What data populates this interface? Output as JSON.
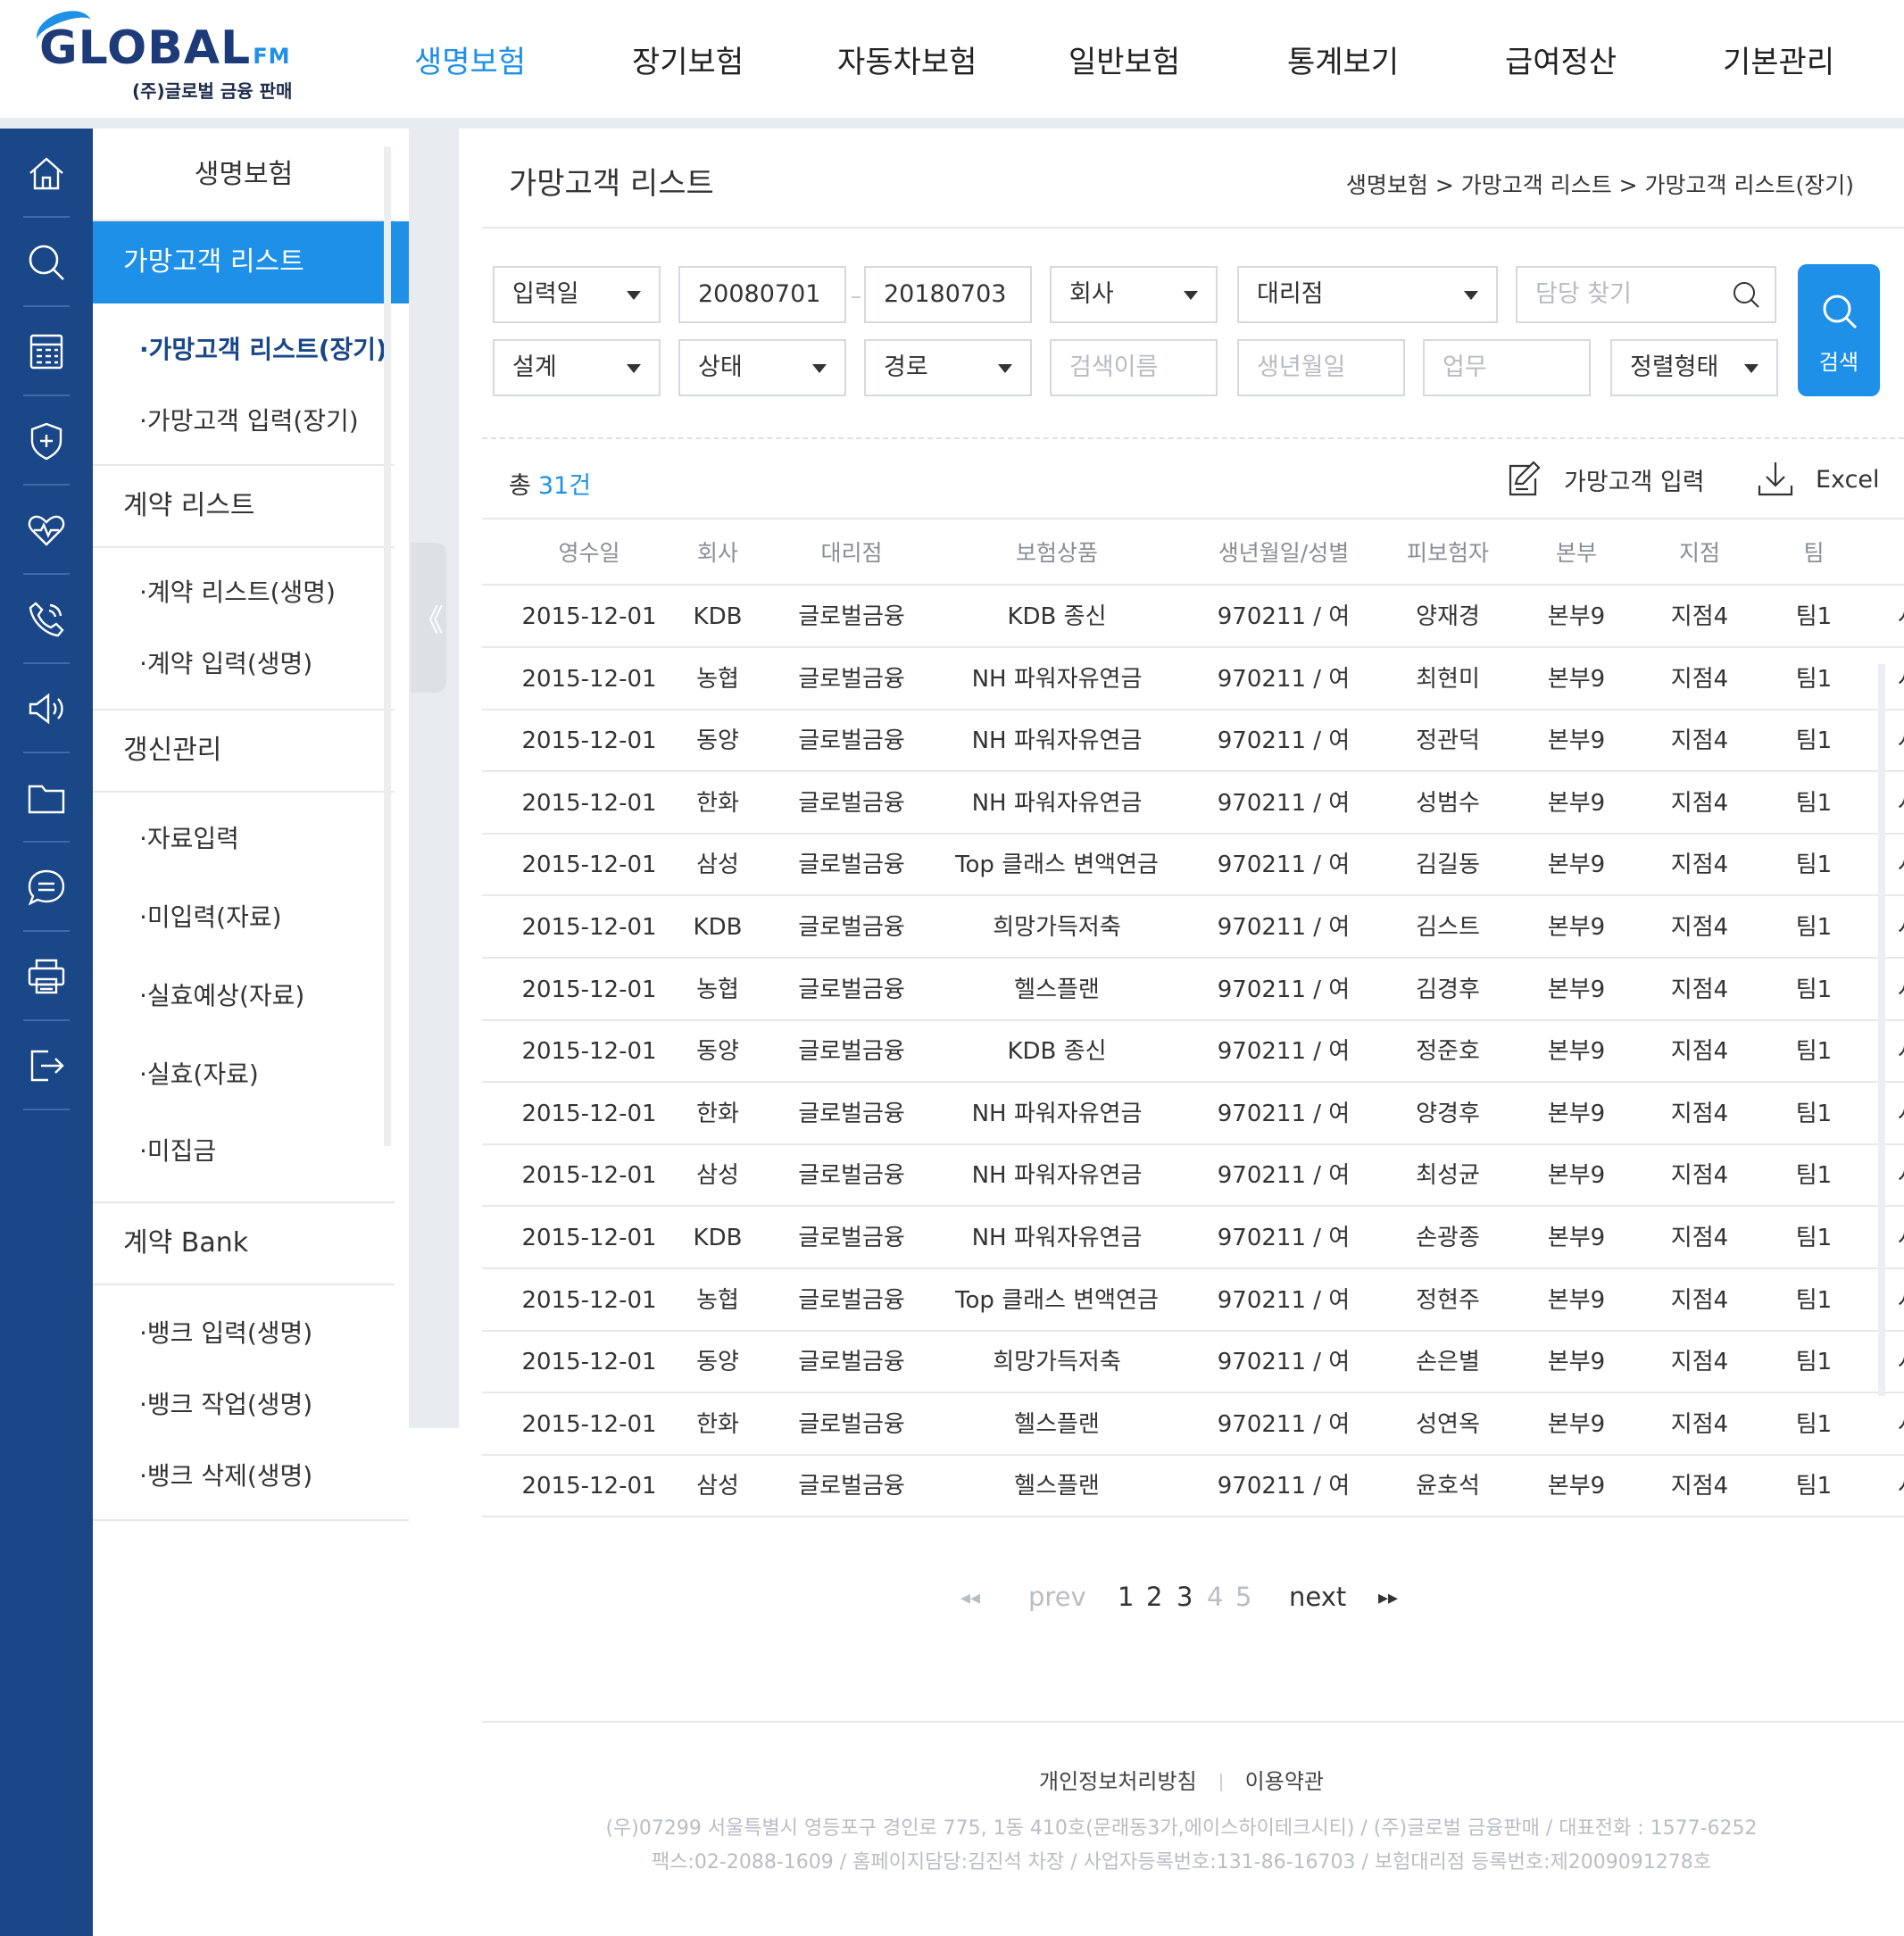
{
  "brand": {
    "logo_text": "GLOBAL",
    "logo_suffix": "FM",
    "logo_sub": "(주)글로벌 금융 판매",
    "accent": "#1e90e8",
    "navy": "#1a4787"
  },
  "gnb": [
    {
      "label": "생명보험",
      "active": true
    },
    {
      "label": "장기보험"
    },
    {
      "label": "자동차보험"
    },
    {
      "label": "일반보험"
    },
    {
      "label": "통계보기"
    },
    {
      "label": "급여정산"
    },
    {
      "label": "기본관리"
    }
  ],
  "iconbar": [
    "home-icon",
    "search-icon",
    "calculator-icon",
    "shield-icon",
    "heart-rate-icon",
    "phone-icon",
    "megaphone-icon",
    "folder-icon",
    "chat-icon",
    "printer-icon",
    "logout-icon"
  ],
  "sidebar": {
    "title": "생명보험",
    "active_section": "가망고객 리스트",
    "links1": [
      "·가망고객 리스트(장기)",
      "·가망고객 입력(장기)"
    ],
    "group2": "계약 리스트",
    "links2": [
      "·계약 리스트(생명)",
      "·계약 입력(생명)"
    ],
    "group3": "갱신관리",
    "links3": [
      "·자료입력",
      "·미입력(자료)",
      "·실효예상(자료)",
      "·실효(자료)",
      "·미집금"
    ],
    "group4": "계약 Bank",
    "links4": [
      "·뱅크 입력(생명)",
      "·뱅크 작업(생명)",
      "·뱅크 삭제(생명)"
    ],
    "collapse_label": "《"
  },
  "page": {
    "title": "가망고객 리스트",
    "breadcrumb": "생명보험  >  가망고객 리스트  >  가망고객 리스트(장기)"
  },
  "filters": {
    "date_type": "입력일",
    "date_from": "20080701",
    "date_to": "20180703",
    "company": "회사",
    "agency": "대리점",
    "manager_placeholder": "담당 찾기",
    "design": "설계",
    "status": "상태",
    "route": "경로",
    "name_placeholder": "검색이름",
    "birth_placeholder": "생년월일",
    "job_placeholder": "업무",
    "sort": "정렬형태",
    "search_label": "검색"
  },
  "summary": {
    "total_label": "총",
    "total_count": "31건",
    "add_label": "가망고객 입력",
    "excel_label": "Excel"
  },
  "table": {
    "headers": [
      "영수일",
      "회사",
      "대리점",
      "보험상품",
      "생년월일/성별",
      "피보험자",
      "본부",
      "지점",
      "팀"
    ],
    "rows": [
      [
        "2015-12-01",
        "KDB",
        "글로벌금융",
        "KDB 종신",
        "970211  / 여",
        "양재경",
        "본부9",
        "지점4",
        "팀1",
        "사:"
      ],
      [
        "2015-12-01",
        "농협",
        "글로벌금융",
        "NH 파워자유연금",
        "970211  / 여",
        "최현미",
        "본부9",
        "지점4",
        "팀1",
        "사:"
      ],
      [
        "2015-12-01",
        "동양",
        "글로벌금융",
        "NH 파워자유연금",
        "970211  / 여",
        "정관덕",
        "본부9",
        "지점4",
        "팀1",
        "사:"
      ],
      [
        "2015-12-01",
        "한화",
        "글로벌금융",
        "NH 파워자유연금",
        "970211  / 여",
        "성범수",
        "본부9",
        "지점4",
        "팀1",
        "사:"
      ],
      [
        "2015-12-01",
        "삼성",
        "글로벌금융",
        "Top 클래스 변액연금",
        "970211  / 여",
        "김길동",
        "본부9",
        "지점4",
        "팀1",
        "사:"
      ],
      [
        "2015-12-01",
        "KDB",
        "글로벌금융",
        "희망가득저축",
        "970211  / 여",
        "김스트",
        "본부9",
        "지점4",
        "팀1",
        "사:"
      ],
      [
        "2015-12-01",
        "농협",
        "글로벌금융",
        "헬스플랜",
        "970211  / 여",
        "김경후",
        "본부9",
        "지점4",
        "팀1",
        "사:"
      ],
      [
        "2015-12-01",
        "동양",
        "글로벌금융",
        "KDB 종신",
        "970211  / 여",
        "정준호",
        "본부9",
        "지점4",
        "팀1",
        "사:"
      ],
      [
        "2015-12-01",
        "한화",
        "글로벌금융",
        "NH 파워자유연금",
        "970211  / 여",
        "양경후",
        "본부9",
        "지점4",
        "팀1",
        "사:"
      ],
      [
        "2015-12-01",
        "삼성",
        "글로벌금융",
        "NH 파워자유연금",
        "970211  / 여",
        "최성균",
        "본부9",
        "지점4",
        "팀1",
        "사:"
      ],
      [
        "2015-12-01",
        "KDB",
        "글로벌금융",
        "NH 파워자유연금",
        "970211  / 여",
        "손광종",
        "본부9",
        "지점4",
        "팀1",
        "사:"
      ],
      [
        "2015-12-01",
        "농협",
        "글로벌금융",
        "Top 클래스 변액연금",
        "970211  / 여",
        "정현주",
        "본부9",
        "지점4",
        "팀1",
        "사:"
      ],
      [
        "2015-12-01",
        "동양",
        "글로벌금융",
        "희망가득저축",
        "970211  / 여",
        "손은별",
        "본부9",
        "지점4",
        "팀1",
        "사:"
      ],
      [
        "2015-12-01",
        "한화",
        "글로벌금융",
        "헬스플랜",
        "970211  / 여",
        "성연옥",
        "본부9",
        "지점4",
        "팀1",
        "사:"
      ],
      [
        "2015-12-01",
        "삼성",
        "글로벌금융",
        "헬스플랜",
        "970211  / 여",
        "윤호석",
        "본부9",
        "지점4",
        "팀1",
        "사:"
      ]
    ]
  },
  "pager": {
    "first": "◂◂",
    "prev": "prev",
    "pages": [
      "1",
      "2",
      "3",
      "4",
      "5"
    ],
    "next": "next",
    "last": "▸▸"
  },
  "footer": {
    "privacy": "개인정보처리방침",
    "terms": "이용약관",
    "line1": "(우)07299 서울특별시 영등포구 경인로 775, 1동 410호(문래동3가,에이스하이테크시티) / (주)글로벌 금융판매 / 대표전화 : 1577-6252",
    "line2": "팩스:02-2088-1609 / 홈페이지담당:김진석 차장 / 사업자등록번호:131-86-16703 / 보험대리점 등록번호:제2009091278호"
  }
}
